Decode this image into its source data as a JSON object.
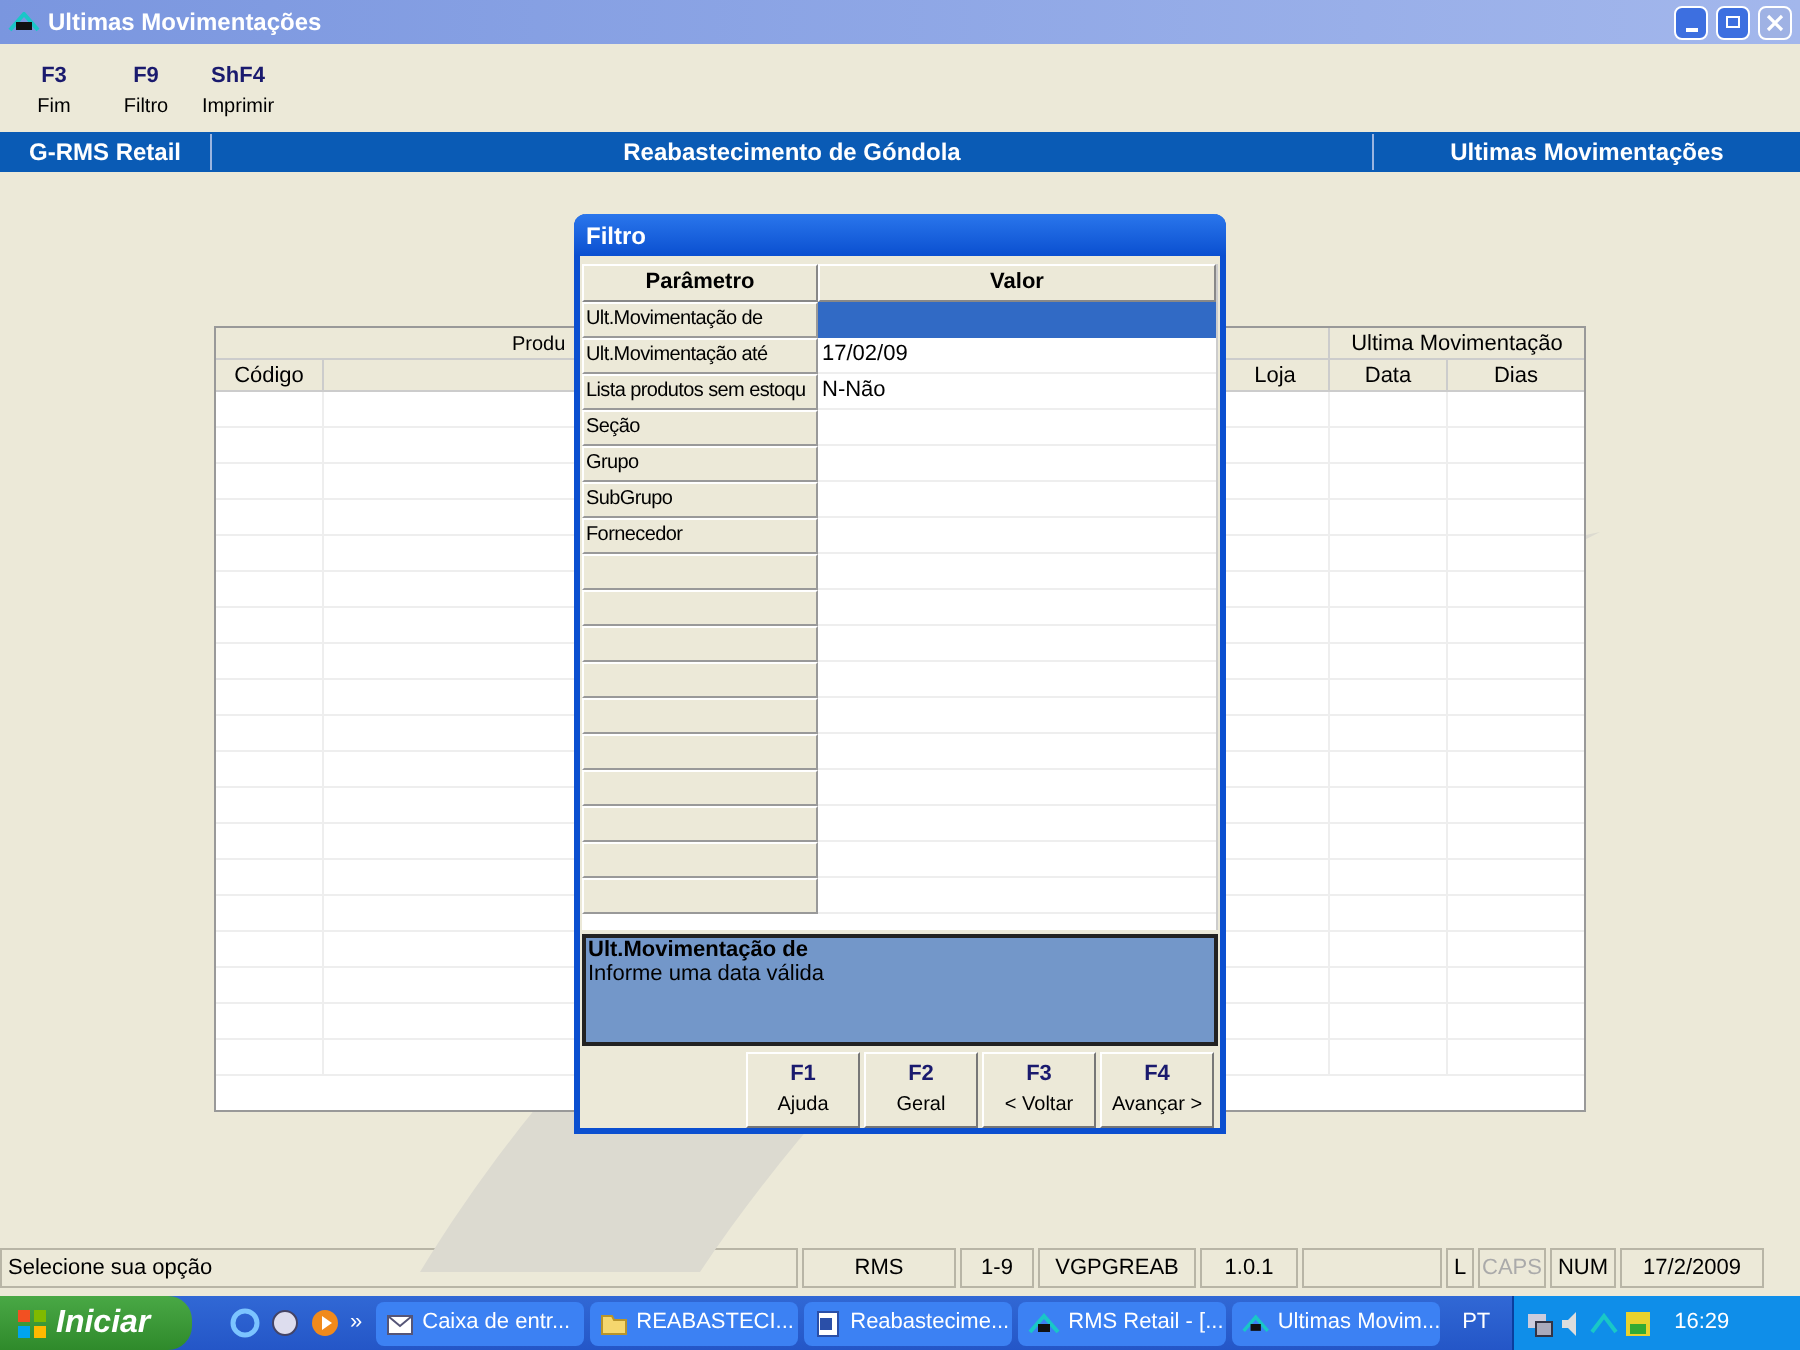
{
  "window": {
    "title": "Ultimas Movimentações"
  },
  "toolbar": [
    {
      "key": "F3",
      "label": "Fim"
    },
    {
      "key": "F9",
      "label": "Filtro"
    },
    {
      "key": "ShF4",
      "label": "Imprimir"
    }
  ],
  "header": {
    "left": "G-RMS Retail",
    "center": "Reabastecimento de Góndola",
    "right": "Ultimas Movimentações"
  },
  "table": {
    "group_headers": [
      "Produ",
      "Ultima Movimentação"
    ],
    "columns": [
      "Código",
      "Loja",
      "Data",
      "Dias"
    ]
  },
  "dialog": {
    "title": "Filtro",
    "columns": [
      "Parâmetro",
      "Valor"
    ],
    "rows": [
      {
        "parameter": "Ult.Movimentação de",
        "selected": true
      },
      {
        "parameter": "Ult.Movimentação até",
        "value": "17/02/09",
        "selected": false
      },
      {
        "parameter": "Lista produtos sem estoqu",
        "value": "N-Não",
        "selected": false
      },
      {
        "parameter": "Seção",
        "selected": false
      },
      {
        "parameter": "Grupo",
        "selected": false
      },
      {
        "parameter": "SubGrupo",
        "selected": false
      },
      {
        "parameter": "Fornecedor",
        "selected": false
      }
    ],
    "help": {
      "title": "Ult.Movimentação de",
      "text": "Informe uma data válida"
    },
    "buttons": [
      {
        "key": "F1",
        "label": "Ajuda"
      },
      {
        "key": "F2",
        "label": "Geral"
      },
      {
        "key": "F3",
        "label": "< Voltar"
      },
      {
        "key": "F4",
        "label": "Avançar >"
      }
    ]
  },
  "status_bar": [
    {
      "kind": "text",
      "text": "Selecione sua opção",
      "disabled": false
    },
    {
      "kind": "text",
      "text": "RMS",
      "disabled": false
    },
    {
      "kind": "text",
      "text": "1-9",
      "disabled": false
    },
    {
      "kind": "text",
      "text": "VGPGREAB",
      "disabled": false
    },
    {
      "kind": "text",
      "text": "1.0.1",
      "disabled": false
    },
    {
      "kind": "blank"
    },
    {
      "kind": "text",
      "text": "L",
      "disabled": false
    },
    {
      "kind": "text",
      "text": "CAPS",
      "disabled": true
    },
    {
      "kind": "text",
      "text": "NUM",
      "disabled": false
    },
    {
      "kind": "text",
      "text": "17/2/2009",
      "disabled": false
    }
  ],
  "taskbar": {
    "start": "Iniciar",
    "chevron": "»",
    "tasks": [
      {
        "kind": "mail",
        "label": "Caixa de entr..."
      },
      {
        "kind": "folder",
        "label": "REABASTECI..."
      },
      {
        "kind": "doc",
        "label": "Reabastecime..."
      },
      {
        "kind": "app",
        "label": "RMS Retail - [..."
      },
      {
        "kind": "app",
        "label": "Ultimas Movim..."
      }
    ],
    "language": "PT",
    "clock": "16:29"
  }
}
